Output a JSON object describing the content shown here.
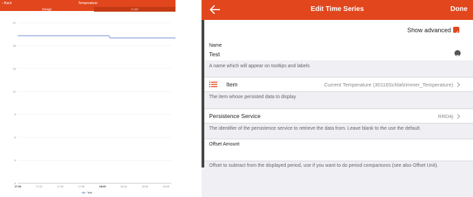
{
  "left_panel": {
    "header": {
      "back_label": "‹ Back",
      "title": "Temperature"
    },
    "tabs": [
      {
        "label": "Design",
        "active": true
      },
      {
        "label": "Code",
        "active": false
      }
    ],
    "accent_color": "#e2461c"
  },
  "chart_data": {
    "type": "line",
    "x": [
      "17:00",
      "17:15",
      "17:30",
      "17:45",
      "18:00",
      "18:15",
      "18:30",
      "18:45"
    ],
    "y_ticks": [
      0,
      3,
      6,
      9,
      12,
      15,
      18,
      21
    ],
    "ylim": [
      0,
      21
    ],
    "series": [
      {
        "name": "Test",
        "color": "#6d89d4",
        "points": [
          [
            0,
            19.3
          ],
          [
            4.3,
            19.3
          ],
          [
            4.35,
            19.0
          ],
          [
            7.6,
            19.0
          ]
        ]
      }
    ],
    "grid": true,
    "legend_position": "bottom-center"
  },
  "right_panel": {
    "header": {
      "title": "Edit Time Series",
      "done_label": "Done"
    },
    "advanced": {
      "label": "Show advanced",
      "checked": true
    },
    "name_field": {
      "label": "Name",
      "value": "Test",
      "note": "A name which will appear on tooltips and labels"
    },
    "item_field": {
      "label": "Item",
      "value": "Current Temperature (30116Schlafzimmer_Temperature)",
      "note": "The item whose persisted data to display"
    },
    "persistence_field": {
      "label": "Persistence Service",
      "value": "RRD4j",
      "note": "The identifier of the persistence service to retrieve the data from. Leave blank to the use the default."
    },
    "offset_field": {
      "label": "Offset Amount",
      "note": "Offset to subtract from the displayed period, use if you want to do period comparisons (see also Offset Unit)."
    }
  }
}
